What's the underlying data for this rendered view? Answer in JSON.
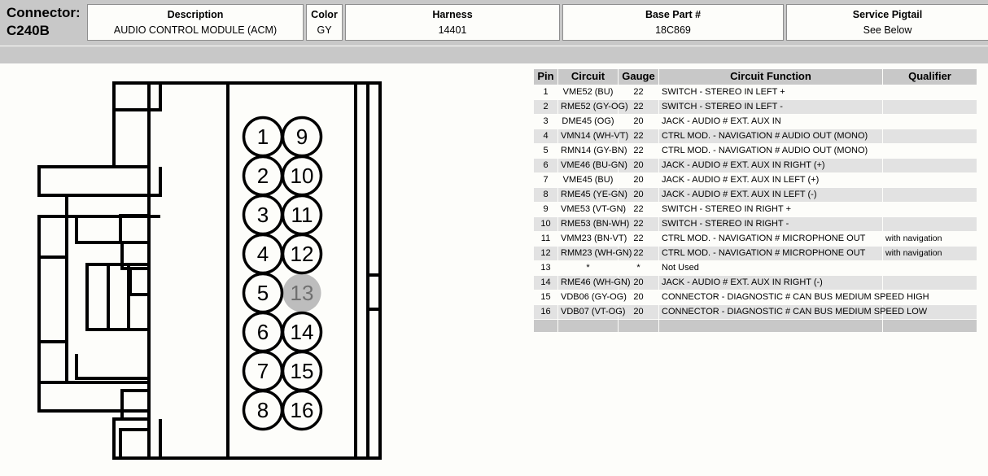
{
  "header": {
    "connector_label_line1": "Connector:",
    "connector_label_line2": "C240B",
    "cells": {
      "description": {
        "title": "Description",
        "value": "AUDIO CONTROL MODULE (ACM)"
      },
      "color": {
        "title": "Color",
        "value": "GY"
      },
      "harness": {
        "title": "Harness",
        "value": "14401"
      },
      "base_part": {
        "title": "Base Part #",
        "value": "18C869"
      },
      "pigtail": {
        "title": "Service Pigtail",
        "value": "See Below"
      }
    }
  },
  "diagram": {
    "name": "connector-pinout-diagram",
    "pins_left_column": [
      "1",
      "2",
      "3",
      "4",
      "5",
      "6",
      "7",
      "8"
    ],
    "pins_right_column": [
      "9",
      "10",
      "11",
      "12",
      "13",
      "14",
      "15",
      "16"
    ],
    "shaded_pin": "13",
    "colors": {
      "outline": "#000000",
      "fill": "#fdfdfa",
      "shaded_pin_fill": "#bdbdbd",
      "shaded_pin_text": "#707070"
    }
  },
  "table": {
    "columns": [
      "Pin",
      "Circuit",
      "Gauge",
      "Circuit Function",
      "Qualifier"
    ],
    "rows": [
      {
        "pin": "1",
        "circuit": "VME52 (BU)",
        "gauge": "22",
        "function": "SWITCH - STEREO IN LEFT +",
        "qualifier": ""
      },
      {
        "pin": "2",
        "circuit": "RME52 (GY-OG)",
        "gauge": "22",
        "function": "SWITCH - STEREO IN LEFT -",
        "qualifier": ""
      },
      {
        "pin": "3",
        "circuit": "DME45 (OG)",
        "gauge": "20",
        "function": "JACK - AUDIO # EXT. AUX IN",
        "qualifier": ""
      },
      {
        "pin": "4",
        "circuit": "VMN14 (WH-VT)",
        "gauge": "22",
        "function": "CTRL MOD. - NAVIGATION # AUDIO OUT (MONO)",
        "qualifier": ""
      },
      {
        "pin": "5",
        "circuit": "RMN14 (GY-BN)",
        "gauge": "22",
        "function": "CTRL MOD. - NAVIGATION # AUDIO OUT (MONO)",
        "qualifier": ""
      },
      {
        "pin": "6",
        "circuit": "VME46 (BU-GN)",
        "gauge": "20",
        "function": "JACK - AUDIO # EXT. AUX IN RIGHT (+)",
        "qualifier": ""
      },
      {
        "pin": "7",
        "circuit": "VME45 (BU)",
        "gauge": "20",
        "function": "JACK - AUDIO # EXT. AUX IN LEFT (+)",
        "qualifier": ""
      },
      {
        "pin": "8",
        "circuit": "RME45 (YE-GN)",
        "gauge": "20",
        "function": "JACK - AUDIO # EXT. AUX IN LEFT (-)",
        "qualifier": ""
      },
      {
        "pin": "9",
        "circuit": "VME53 (VT-GN)",
        "gauge": "22",
        "function": "SWITCH - STEREO IN RIGHT +",
        "qualifier": ""
      },
      {
        "pin": "10",
        "circuit": "RME53 (BN-WH)",
        "gauge": "22",
        "function": "SWITCH - STEREO IN RIGHT -",
        "qualifier": ""
      },
      {
        "pin": "11",
        "circuit": "VMM23 (BN-VT)",
        "gauge": "22",
        "function": "CTRL MOD. - NAVIGATION # MICROPHONE OUT",
        "qualifier": "with navigation"
      },
      {
        "pin": "12",
        "circuit": "RMM23 (WH-GN)",
        "gauge": "22",
        "function": "CTRL MOD. - NAVIGATION # MICROPHONE OUT",
        "qualifier": "with navigation"
      },
      {
        "pin": "13",
        "circuit": "*",
        "gauge": "*",
        "function": "Not Used",
        "qualifier": ""
      },
      {
        "pin": "14",
        "circuit": "RME46 (WH-GN)",
        "gauge": "20",
        "function": "JACK - AUDIO # EXT. AUX IN RIGHT (-)",
        "qualifier": ""
      },
      {
        "pin": "15",
        "circuit": "VDB06 (GY-OG)",
        "gauge": "20",
        "function": "CONNECTOR - DIAGNOSTIC # CAN BUS MEDIUM SPEED HIGH",
        "qualifier": ""
      },
      {
        "pin": "16",
        "circuit": "VDB07 (VT-OG)",
        "gauge": "20",
        "function": "CONNECTOR - DIAGNOSTIC # CAN BUS MEDIUM SPEED LOW",
        "qualifier": ""
      }
    ]
  },
  "colors": {
    "band_gray": "#c8c8c8",
    "row_shade": "#e2e2e2",
    "page_bg": "#fdfdfa",
    "border": "#8e8e8e"
  }
}
